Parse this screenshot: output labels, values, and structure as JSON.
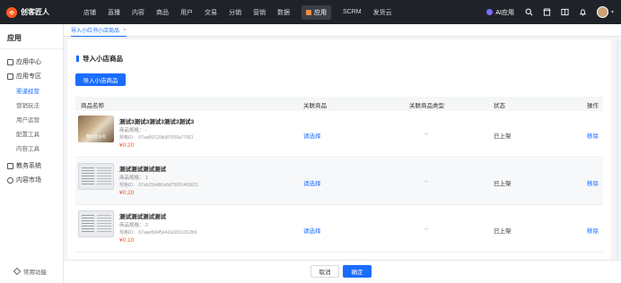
{
  "app": {
    "logo_text": "创客匠人"
  },
  "nav": {
    "items": [
      "店铺",
      "直播",
      "内容",
      "商品",
      "用户",
      "交易",
      "分销",
      "营销",
      "数据"
    ],
    "active": "应用",
    "after": [
      "SCRM",
      "发货云"
    ]
  },
  "tools": {
    "ai_label": "AI应用"
  },
  "sidebar": {
    "title": "应用",
    "app_center": "应用中心",
    "zone": "应用专区",
    "subs": [
      "渠道经营",
      "营销玩法",
      "用户运营",
      "配置工具",
      "内容工具"
    ],
    "edu": "教务系统",
    "market": "内容市场",
    "footer": "常用功能"
  },
  "breadcrumb": {
    "tab": "导入小红书小店商品",
    "close": "×"
  },
  "section": {
    "title": "导入小店商品",
    "import_button": "导入小店商品"
  },
  "table": {
    "headers": {
      "name": "商品名称",
      "related": "关联商品",
      "related_type": "关联商品类型",
      "status": "状态",
      "action": "操作"
    },
    "rows": [
      {
        "name": "测试3测试3测试3测试3测试3",
        "spec": "商品规格： -",
        "id": "规格ID： 67aaf60129b9f7000a77061",
        "price": "¥0.20",
        "related": "请选择",
        "related_type": "--",
        "status": "已上架",
        "action": "移除",
        "thumb_caption": "我也是没有"
      },
      {
        "name": "测试测试测试测试",
        "spec": "商品规格： 1",
        "id": "规格ID： 67ab15b486a5d70001466621",
        "price": "¥0.20",
        "related": "请选择",
        "related_type": "--",
        "status": "已上架",
        "action": "移除"
      },
      {
        "name": "测试测试测试测试",
        "spec": "商品规格： 2",
        "id": "规格ID： 67aaefbd45e42a0001c813b6",
        "price": "¥0.10",
        "related": "请选择",
        "related_type": "--",
        "status": "已上架",
        "action": "移除"
      }
    ]
  },
  "footer": {
    "cancel": "取消",
    "confirm": "确定"
  },
  "colors": {
    "primary": "#1a6dff",
    "price": "#ff4d2e",
    "topbar": "#1f2329"
  }
}
